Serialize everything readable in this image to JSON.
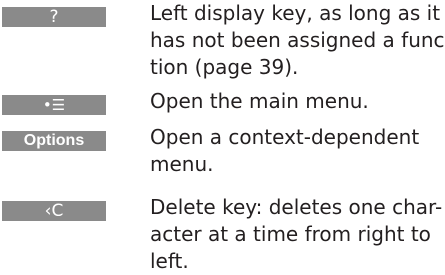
{
  "rows": [
    {
      "key_label": "?",
      "lines": [
        "Left display key, as long as it",
        "has not been assigned a func-",
        "tion (page 39)."
      ]
    },
    {
      "key_label": "•☰",
      "lines": [
        "Open the main menu."
      ]
    },
    {
      "key_label": "Options",
      "lines": [
        "Open a context-dependent",
        "menu."
      ]
    },
    {
      "key_label": "‹C",
      "lines": [
        "Delete key: deletes one char-",
        "acter at a time from right to",
        "left."
      ]
    }
  ]
}
